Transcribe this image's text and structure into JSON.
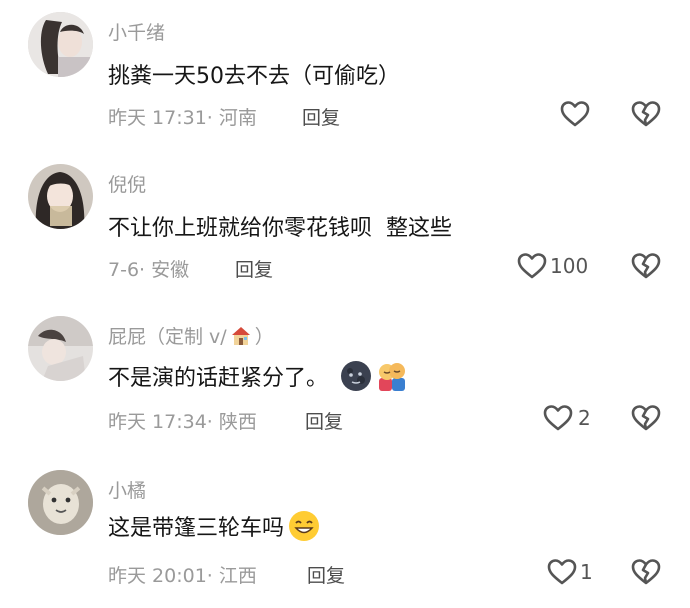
{
  "comments": [
    {
      "username": "小千绪",
      "text": "挑粪一天50去不去（可偷吃）",
      "meta": "昨天 17:31· 河南",
      "reply": "回复",
      "likes": ""
    },
    {
      "username": "倪倪",
      "text": "不让你上班就给你零花钱呗  整这些",
      "meta": "7-6· 安徽",
      "reply": "回复",
      "likes": "100"
    },
    {
      "username_prefix": "屁屁（定制 v/",
      "username_suffix": "）",
      "text": "不是演的话赶紧分了。",
      "meta": "昨天 17:34· 陕西",
      "reply": "回复",
      "likes": "2"
    },
    {
      "username": "小橘",
      "text": "这是带篷三轮车吗",
      "meta": "昨天 20:01· 江西",
      "reply": "回复",
      "likes": "1"
    }
  ],
  "icons": {
    "like": "heart-outline-icon",
    "dislike": "broken-heart-icon",
    "emoji_1": "new-moon-face-emoji",
    "emoji_2": "hugging-people-emoji",
    "emoji_3": "grinning-face-emoji",
    "username_badge": "house-emoji"
  },
  "colors": {
    "username": "#9a9a9a",
    "text": "#161616",
    "meta": "#9a9a9a",
    "reply": "#4d4d4d",
    "icon": "#555555"
  }
}
